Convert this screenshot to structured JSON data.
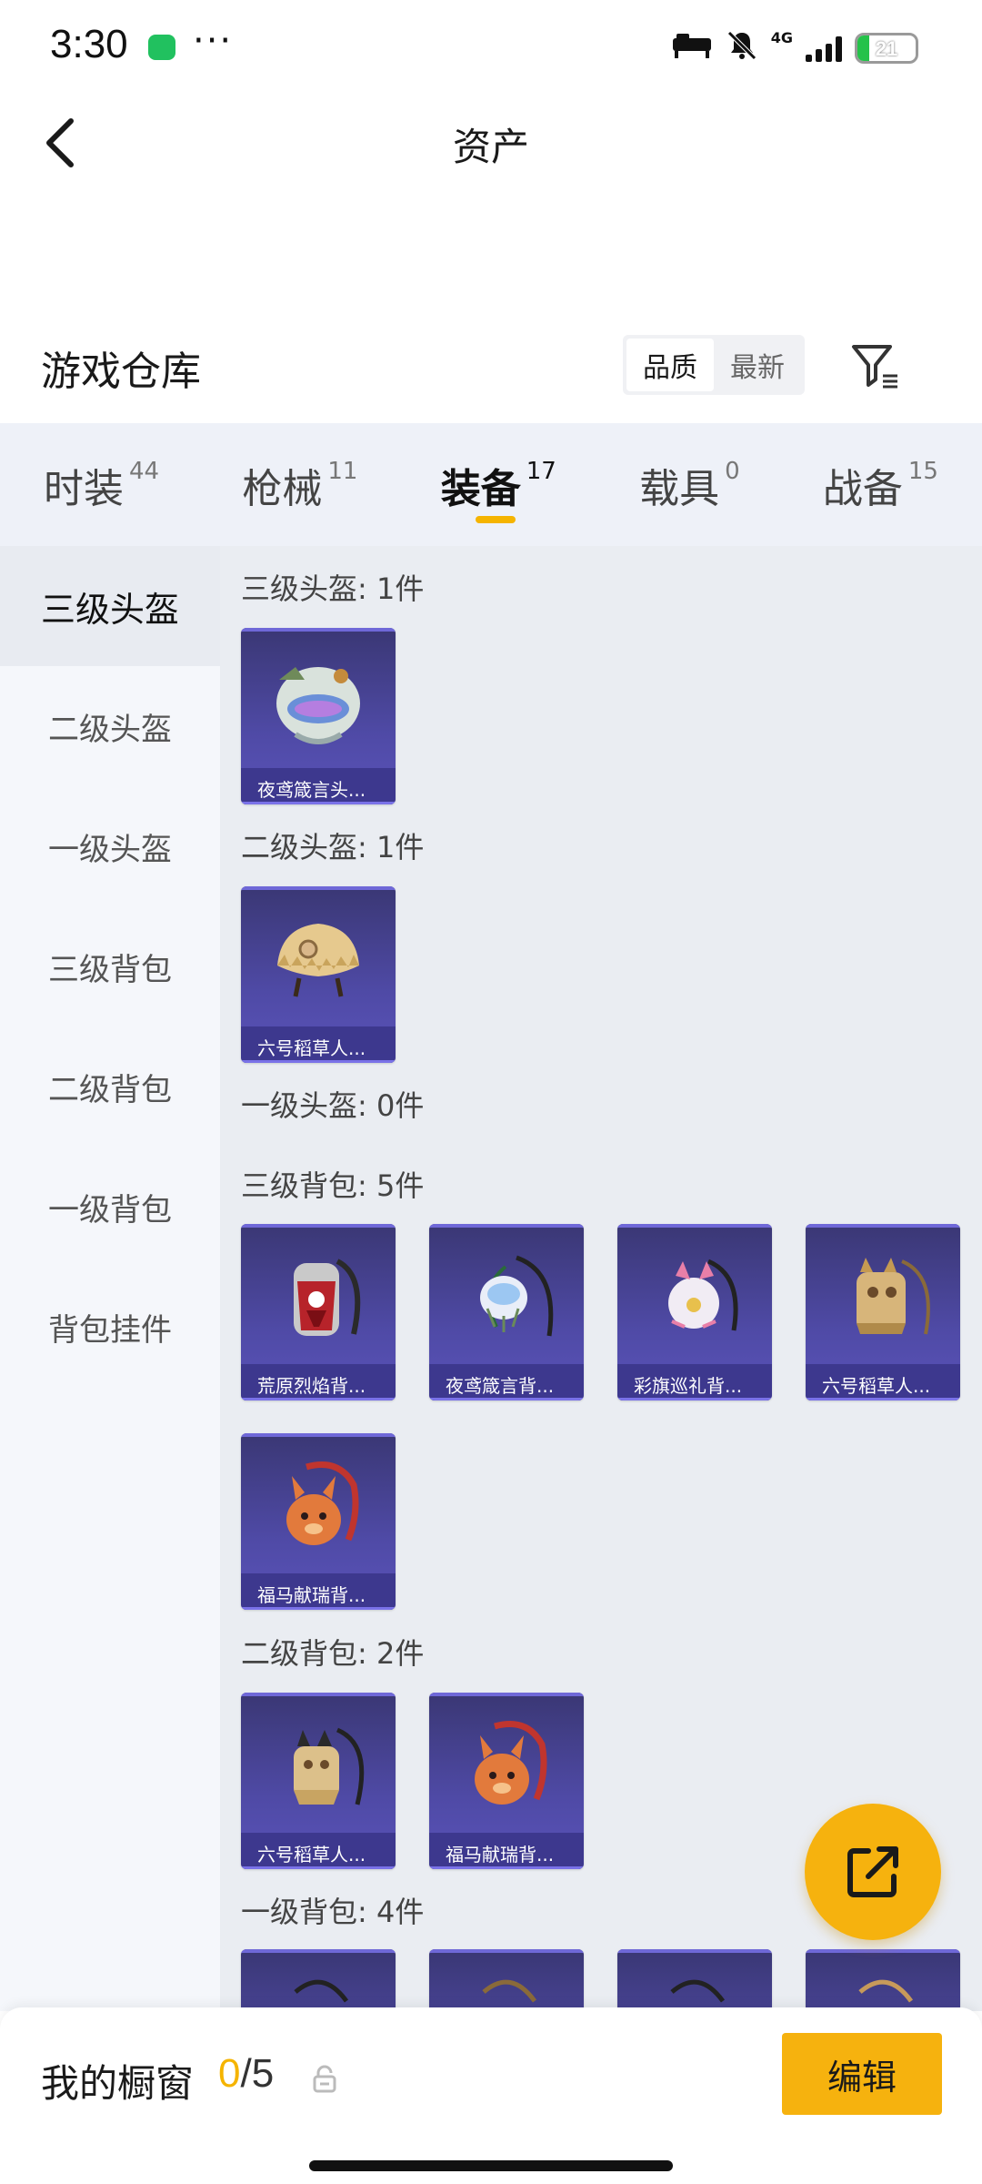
{
  "status_bar": {
    "time": "3:30",
    "dots": "···",
    "network": "4G",
    "battery": "21",
    "battery_fraction": 0.21
  },
  "header": {
    "title": "资产"
  },
  "warehouse": {
    "title": "游戏仓库",
    "sort_options": [
      "品质",
      "最新"
    ],
    "active_sort": "品质"
  },
  "categories": [
    {
      "label": "时装",
      "count": "44"
    },
    {
      "label": "枪械",
      "count": "11"
    },
    {
      "label": "装备",
      "count": "17",
      "active": true
    },
    {
      "label": "载具",
      "count": "0"
    },
    {
      "label": "战备",
      "count": "15"
    }
  ],
  "sidebar": {
    "items": [
      "三级头盔",
      "二级头盔",
      "一级头盔",
      "三级背包",
      "二级背包",
      "一级背包",
      "背包挂件"
    ],
    "active": "三级头盔"
  },
  "sections": [
    {
      "header": "三级头盔: 1件",
      "items": [
        "夜鸢箴言头..."
      ]
    },
    {
      "header": "二级头盔: 1件",
      "items": [
        "六号稻草人..."
      ]
    },
    {
      "header": "一级头盔: 0件",
      "items": []
    },
    {
      "header": "三级背包: 5件",
      "items": [
        "荒原烈焰背...",
        "夜鸢箴言背...",
        "彩旗巡礼背...",
        "六号稻草人...",
        "福马献瑞背..."
      ]
    },
    {
      "header": "二级背包: 2件",
      "items": [
        "六号稻草人...",
        "福马献瑞背..."
      ]
    },
    {
      "header": "一级背包: 4件",
      "items": [
        "",
        "",
        "",
        ""
      ]
    }
  ],
  "showcase": {
    "label": "我的橱窗",
    "current": "0",
    "separator": "/",
    "total": "5",
    "edit_label": "编辑"
  },
  "colors": {
    "accent": "#f6b20e",
    "card_purple": "#4f4aa6",
    "tab_bg": "#eef1f8"
  },
  "icons": {
    "back": "chevron-left-icon",
    "filter": "filter-icon",
    "share": "share-external-icon",
    "lock": "lock-icon"
  }
}
